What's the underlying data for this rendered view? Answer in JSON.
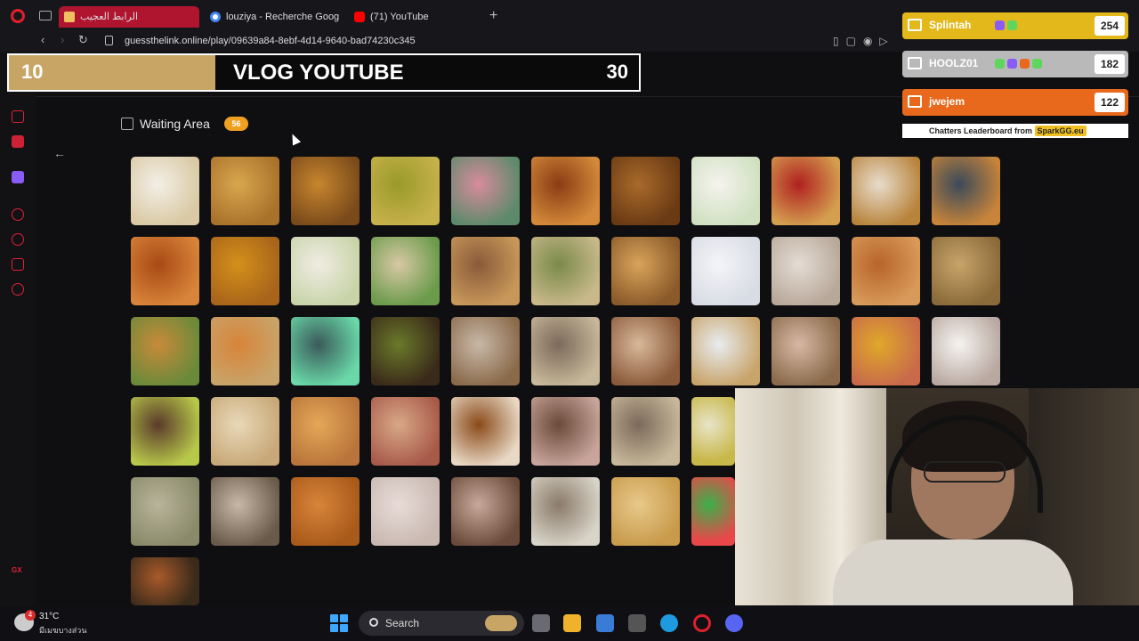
{
  "browser": {
    "tabs": [
      {
        "title": "الرابط العجيب",
        "active": true
      },
      {
        "title": "louziya - Recherche Goog",
        "active": false
      },
      {
        "title": "(71) YouTube",
        "active": false
      }
    ],
    "new_tab_icon": "plus-icon",
    "url": "guessthelink.online/play/09639a84-8ebf-4d14-9640-bad74230c345"
  },
  "overlay": {
    "left_number": "10",
    "title": "VLOG YOUTUBE",
    "right_number": "30"
  },
  "waiting_area": {
    "title": "Waiting Area",
    "count": "56"
  },
  "leaderboard": {
    "rows": [
      {
        "name": "Splintah",
        "score": "254",
        "color": "#e2b81a"
      },
      {
        "name": "HOOLZ01",
        "score": "182",
        "color": "#b9b9b9"
      },
      {
        "name": "jwejem",
        "score": "122",
        "color": "#e8681c"
      }
    ],
    "footer_text": "Chatters Leaderboard from",
    "footer_brand": "SparkGG.eu"
  },
  "taskbar": {
    "weather_temp": "31°C",
    "weather_desc": "มีเมฆบางส่วน",
    "weather_badge": "4",
    "search_label": "Search"
  },
  "colors": {
    "accent_red": "#b01530",
    "badge_orange": "#f0a020",
    "banner_gold": "#c9a565"
  }
}
